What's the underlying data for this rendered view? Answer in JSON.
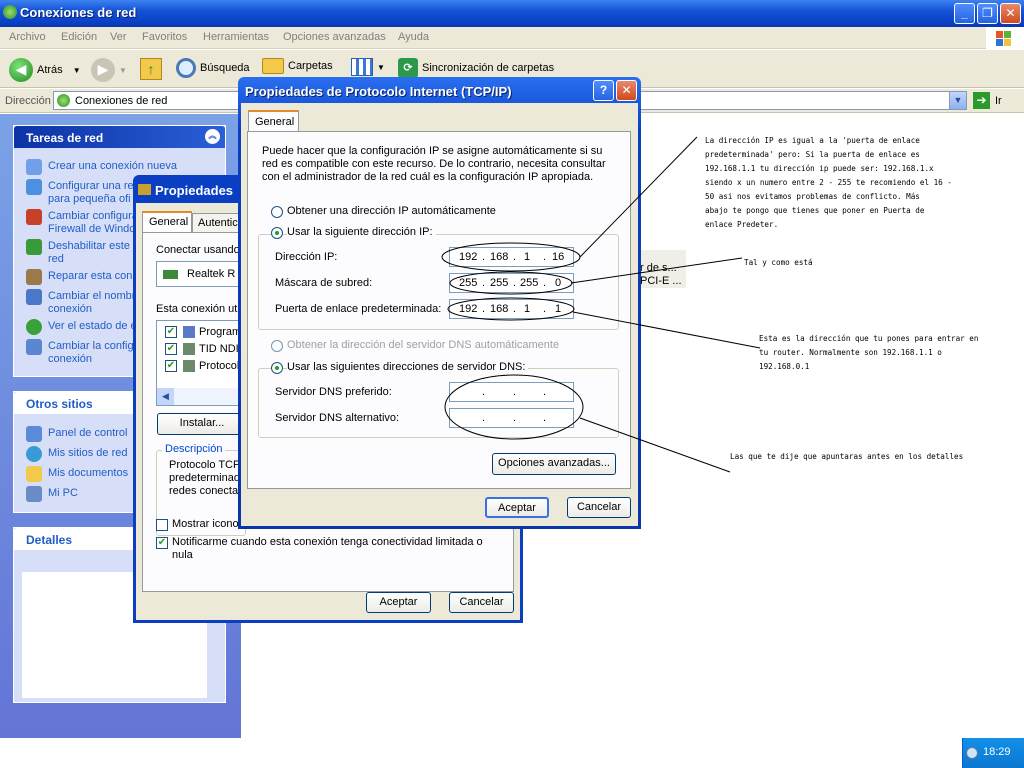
{
  "explorer": {
    "title": "Conexiones de red",
    "menu": [
      "Archivo",
      "Edición",
      "Ver",
      "Favoritos",
      "Herramientas",
      "Opciones avanzadas",
      "Ayuda"
    ],
    "toolbar": {
      "back": "Atrás",
      "search": "Búsqueda",
      "folders": "Carpetas",
      "sync": "Sincronización de carpetas"
    },
    "address_label": "Dirección",
    "address_value": "Conexiones de red",
    "go": "Ir",
    "right_items": [
      "r de s...",
      "PCI-E ..."
    ]
  },
  "taskpane": {
    "network_tasks": {
      "title": "Tareas de red",
      "items": [
        [
          "Crear una conexión nueva"
        ],
        [
          "Configurar una re",
          "para pequeña ofi"
        ],
        [
          "Cambiar configura",
          "Firewall de Windo"
        ],
        [
          "Deshabilitar este",
          "red"
        ],
        [
          "Reparar esta con"
        ],
        [
          "Cambiar el nombr",
          "conexión"
        ],
        [
          "Ver el estado de e"
        ],
        [
          "Cambiar la config",
          "conexión"
        ]
      ]
    },
    "other_places": {
      "title": "Otros sitios",
      "items": [
        "Panel de control",
        "Mis sitios de red",
        "Mis documentos",
        "Mi PC"
      ]
    },
    "details": {
      "title": "Detalles"
    }
  },
  "props_dialog": {
    "title": "Propiedades",
    "tabs": [
      "General",
      "Autentic"
    ],
    "connect_using": "Conectar usando",
    "adapter": "Realtek R",
    "uses_label": "Esta conexión uti",
    "components": [
      "Program",
      "TID NDI",
      "Protocolo"
    ],
    "install": "Instalar...",
    "description_title": "Descripción",
    "description": [
      "Protocolo TCP",
      "predeterminado",
      "redes conecta"
    ],
    "show_icon": "Mostrar icono",
    "notify": [
      "Notificarme cuando esta conexión tenga conectividad limitada o",
      "nula"
    ],
    "ok": "Aceptar",
    "cancel": "Cancelar"
  },
  "tcpip_dialog": {
    "title": "Propiedades de Protocolo Internet (TCP/IP)",
    "help": "?",
    "tab": "General",
    "intro": [
      "Puede hacer que la configuración IP se asigne automáticamente si su",
      "red es compatible con este recurso. De lo contrario, necesita consultar",
      "con el administrador de la red cuál es la configuración IP apropiada."
    ],
    "auto_ip": "Obtener una dirección IP automáticamente",
    "manual_ip": "Usar la siguiente dirección IP:",
    "ip_label": "Dirección IP:",
    "ip": [
      "192",
      "168",
      "1",
      "16"
    ],
    "mask_label": "Máscara de subred:",
    "mask": [
      "255",
      "255",
      "255",
      "0"
    ],
    "gw_label": "Puerta de enlace predeterminada:",
    "gw": [
      "192",
      "168",
      "1",
      "1"
    ],
    "auto_dns": "Obtener la dirección del servidor DNS automáticamente",
    "manual_dns": "Usar las siguientes direcciones de servidor DNS:",
    "dns1_label": "Servidor DNS preferido:",
    "dns2_label": "Servidor DNS alternativo:",
    "dot": ".",
    "advanced": "Opciones avanzadas...",
    "ok": "Aceptar",
    "cancel": "Cancelar"
  },
  "annotations": {
    "note1": [
      "La dirección IP es igual a la 'puerta de enlace",
      "predeterminada' pero: Si la puerta de enlace es",
      "192.168.1.1 tu dirección ip puede ser: 192.168.1.x",
      "siendo x un numero entre 2 - 255 te recomiendo el 16 -",
      "50 asi nos evitamos problemas de conflicto. Más",
      "abajo te pongo que tienes que poner en Puerta de",
      "enlace Predeter."
    ],
    "note2": "Tal y como está",
    "note3": [
      "Esta es la dirección que tu pones para entrar en",
      "tu router. Normalmente son 192.168.1.1 o",
      "192.168.0.1"
    ],
    "note4": "Las que te dije que apuntaras antes en los detalles"
  },
  "taskbar": {
    "clock": "18:29"
  }
}
